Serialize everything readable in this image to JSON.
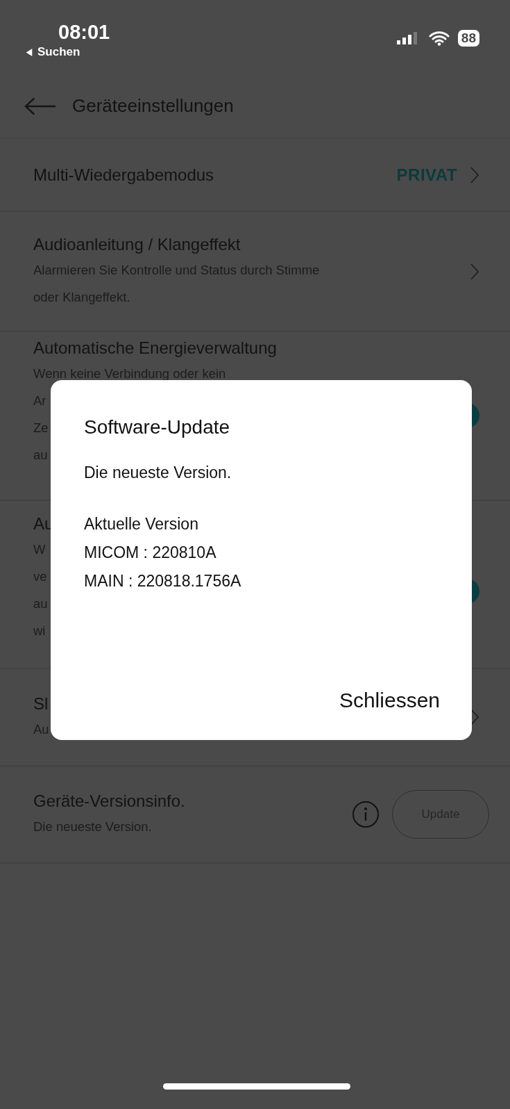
{
  "status_bar": {
    "time": "08:01",
    "back_app": "Suchen",
    "battery": "88"
  },
  "header": {
    "title": "Geräteeinstellungen"
  },
  "rows": [
    {
      "kind": "chevron",
      "title": "Multi-Wiedergabemodus",
      "value": "PRIVAT",
      "lines": []
    },
    {
      "kind": "chevron",
      "title": "Audioanleitung / Klangeffekt",
      "lines": [
        "Alarmieren Sie Kontrolle und Status durch Stimme",
        "oder Klangeffekt."
      ]
    },
    {
      "kind": "toggle",
      "title": "Automatische Energieverwaltung",
      "on": true,
      "lines": [
        "Wenn keine Verbindung oder kein",
        "Ar",
        "Ze",
        "au"
      ]
    },
    {
      "kind": "toggle",
      "title": "Au",
      "on": true,
      "lines": [
        "W",
        "ve",
        "au",
        "wi"
      ]
    },
    {
      "kind": "chevron",
      "title": "Sl",
      "lines": [
        "Au"
      ]
    },
    {
      "kind": "version",
      "title": "Geräte-Versionsinfo.",
      "lines": [
        "Die neueste Version."
      ],
      "button": "Update",
      "disabled": true
    }
  ],
  "dialog": {
    "title": "Software-Update",
    "message": "Die neueste Version.",
    "details": [
      "Aktuelle Version",
      "MICOM : 220810A",
      "MAIN : 220818.1756A"
    ],
    "button": "Schliessen"
  }
}
